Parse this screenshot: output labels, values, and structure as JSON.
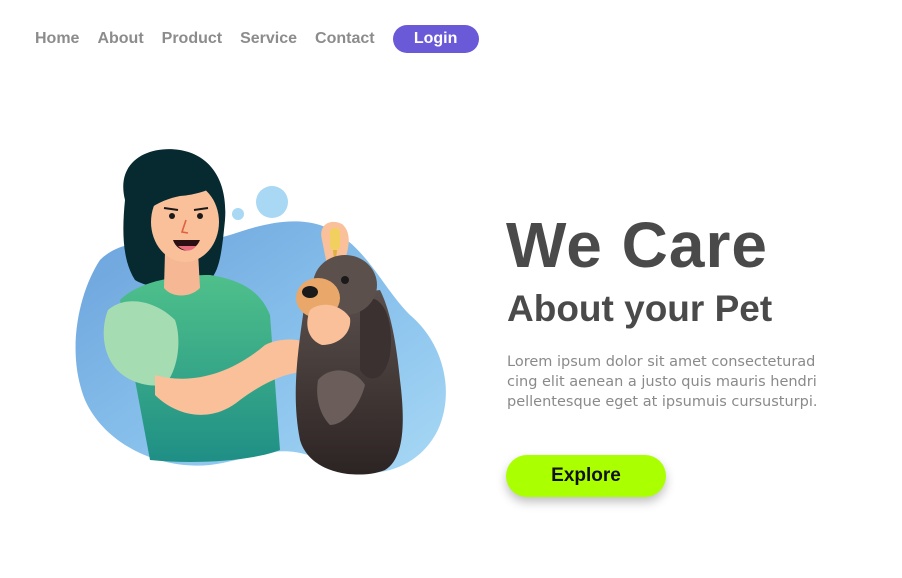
{
  "nav": {
    "items": [
      {
        "label": "Home"
      },
      {
        "label": "About"
      },
      {
        "label": "Product"
      },
      {
        "label": "Service"
      },
      {
        "label": "Contact"
      }
    ],
    "login_label": "Login"
  },
  "hero": {
    "title": "We Care",
    "subtitle": "About your Pet",
    "description": "Lorem ipsum dolor sit amet consectetur adipiscing elit aenean a justo quis mauris hendrerit pellentesque eget at ipsumuis cursusturpi.",
    "description_lines": [
      "Lorem ipsum dolor sit amet consecteturad",
      "cing elit aenean a justo quis mauris hendri",
      "pellentesque eget at ipsumuis cursusturpi."
    ],
    "explore_label": "Explore"
  },
  "illustration": {
    "icon": "woman-giving-dog-eye-drops-illustration"
  },
  "colors": {
    "nav_text": "#8c8c8c",
    "login_bg": "#6a5ad8",
    "explore_bg": "#aaff00",
    "heading_text": "#4a4a4a",
    "body_text": "#8a8a8a"
  }
}
